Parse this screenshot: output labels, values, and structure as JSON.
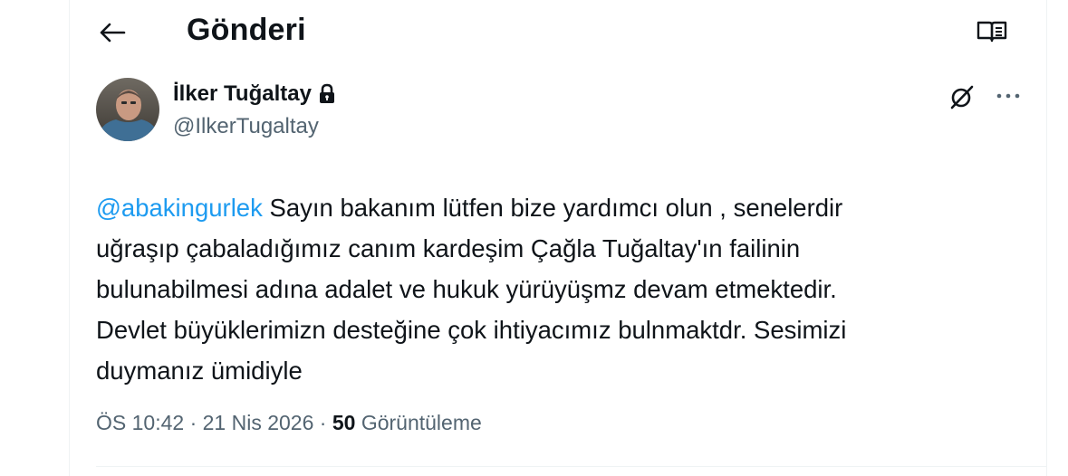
{
  "header": {
    "title": "Gönderi"
  },
  "author": {
    "display_name": "İlker Tuğaltay",
    "handle": "@IlkerTugaltay"
  },
  "tweet": {
    "mention": "@abakingurlek",
    "line1_rest": " Sayın bakanım lütfen bize yardımcı olun , senelerdir",
    "line2": "uğraşıp çabaladığımız canım kardeşim Çağla Tuğaltay'ın failinin",
    "line3": "bulunabilmesi adına adalet ve hukuk yürüyüşmz devam etmektedir.",
    "line4": "Devlet büyüklerimizn desteğine çok ihtiyacımız bulnmaktdr. Sesimizi",
    "line5": "duymanız ümidiyle"
  },
  "meta": {
    "time": "ÖS 10:42",
    "sep1": " · ",
    "date": "21 Nis 2026",
    "sep2": " · ",
    "views_count": "50",
    "views_label": " Görüntüleme"
  },
  "icons": {
    "back": "arrow-left-icon",
    "reader": "reader-mode-icon",
    "lock": "lock-icon",
    "grok": "grok-icon",
    "more": "more-dots-icon"
  },
  "colors": {
    "accent": "#1d9bf0",
    "text": "#0f1419",
    "secondary": "#536471"
  }
}
